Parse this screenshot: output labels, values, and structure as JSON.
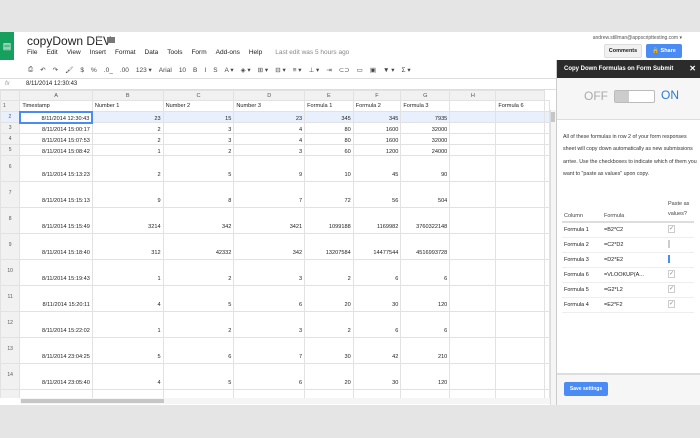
{
  "doc": {
    "title": "copyDown DEV",
    "last_edit": "Last edit was 5 hours ago",
    "user": "andrew.stillman@appscripttesting.com ▾"
  },
  "menu": [
    "File",
    "Edit",
    "View",
    "Insert",
    "Format",
    "Data",
    "Tools",
    "Form",
    "Add-ons",
    "Help"
  ],
  "buttons": {
    "comments": "Comments",
    "share": "🔒 Share"
  },
  "toolbar": {
    "font": "Arial",
    "size": "10",
    "items": [
      "⎙",
      "↶",
      "↷",
      "🖌",
      "$",
      "%",
      ".0_",
      ".00",
      "123 ▾",
      "B",
      "I",
      "S",
      "A ▾",
      "◈ ▾",
      "⊞ ▾",
      "⊟ ▾",
      "≡ ▾",
      "⊥ ▾",
      "⇥",
      "⊂⊃",
      "▭",
      "▣",
      "▼ ▾",
      "Σ ▾"
    ]
  },
  "formula_bar": {
    "fx": "fx",
    "value": "8/11/2014 12:30:43"
  },
  "grid": {
    "columns": [
      "",
      "A",
      "B",
      "C",
      "D",
      "E",
      "F",
      "G",
      "H",
      ""
    ],
    "header_row": [
      "Timestamp",
      "Number 1",
      "Number 2",
      "Number 3",
      "Formula 1",
      "Formula 2",
      "Formula 3",
      "",
      "Formula 6"
    ],
    "rows": [
      [
        "8/11/2014 12:30:43",
        "23",
        "15",
        "23",
        "345",
        "345",
        "7935",
        "",
        ""
      ],
      [
        "8/11/2014 15:00:17",
        "2",
        "3",
        "4",
        "80",
        "1600",
        "32000",
        "",
        ""
      ],
      [
        "8/11/2014 15:07:53",
        "2",
        "3",
        "4",
        "80",
        "1600",
        "32000",
        "",
        ""
      ],
      [
        "8/11/2014 15:08:42",
        "1",
        "2",
        "3",
        "60",
        "1200",
        "24000",
        "",
        ""
      ],
      [
        "8/11/2014 15:13:23",
        "2",
        "5",
        "9",
        "10",
        "45",
        "90",
        "",
        ""
      ],
      [
        "8/11/2014 15:15:13",
        "9",
        "8",
        "7",
        "72",
        "56",
        "504",
        "",
        ""
      ],
      [
        "8/11/2014 15:15:49",
        "3214",
        "342",
        "3421",
        "1099188",
        "1169982",
        "3760322148",
        "",
        ""
      ],
      [
        "8/11/2014 15:18:40",
        "312",
        "42332",
        "342",
        "13207584",
        "14477544",
        "4516993728",
        "",
        ""
      ],
      [
        "8/11/2014 15:19:43",
        "1",
        "2",
        "3",
        "2",
        "6",
        "6",
        "",
        ""
      ],
      [
        "8/11/2014 15:20:11",
        "4",
        "5",
        "6",
        "20",
        "30",
        "120",
        "",
        ""
      ],
      [
        "8/11/2014 15:22:02",
        "1",
        "2",
        "3",
        "2",
        "6",
        "6",
        "",
        ""
      ],
      [
        "8/11/2014 23:04:25",
        "5",
        "6",
        "7",
        "30",
        "42",
        "210",
        "",
        ""
      ],
      [
        "8/11/2014 23:05:40",
        "4",
        "5",
        "6",
        "20",
        "30",
        "120",
        "",
        ""
      ],
      [
        "",
        "",
        "",
        "",
        "",
        "",
        "",
        "",
        ""
      ]
    ]
  },
  "sidebar": {
    "title": "Copy Down Formulas on Form Submit",
    "close": "✕",
    "toggle": {
      "off": "OFF",
      "on": "ON",
      "state": "on"
    },
    "description": "All of these formulas in row 2 of your form responses sheet will copy down automatically as new submissions arrive. Use the checkboxes to indicate which of them you want to \"paste as values\" upon copy.",
    "headers": [
      "Column",
      "Formula",
      "Paste as values?"
    ],
    "rows": [
      {
        "column": "Formula 1",
        "formula": "=B2*C2",
        "checked": true
      },
      {
        "column": "Formula 2",
        "formula": "=C2*D2",
        "checked": false
      },
      {
        "column": "Formula 3",
        "formula": "=D2*E2",
        "checked": false
      },
      {
        "column": "Formula 6",
        "formula": "=VLOOKUP(A...",
        "checked": true
      },
      {
        "column": "Formula 5",
        "formula": "=G2*L2",
        "checked": true
      },
      {
        "column": "Formula 4",
        "formula": "=E2*F2",
        "checked": true
      }
    ],
    "save": "Save settings"
  },
  "colors": {
    "accent": "#4b8bf4",
    "sheets_green": "#16a05d",
    "on": "#2a7bd3"
  }
}
